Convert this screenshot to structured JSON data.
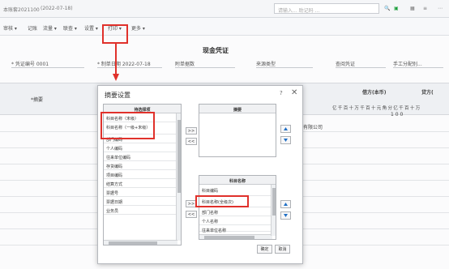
{
  "window": {
    "doc_code": "本账套2021100",
    "date_top": "(2022-07-18)",
    "search_placeholder": "请输入... 助记码 ..."
  },
  "toolbar": {
    "items": [
      "审核 ▾",
      "记账",
      "流量 ▾",
      "联查 ▾",
      "设置 ▾",
      "打印 ▾",
      "更多 ▾"
    ]
  },
  "voucher": {
    "title": "现金凭证",
    "voucher_no_label": "* 凭证编号 0001",
    "date_label": "* 制单日期 2022-07-18",
    "attach_label": "附单据数",
    "source_label": "来源类型",
    "summary_label": "查阅凭证",
    "manual_label": "手工分配别...",
    "col_summary": "*摘要",
    "col_debit": "借方(本币)",
    "col_credit": "贷方(",
    "money_units": "亿 千 百 十 万 千 百 十 元 角 分 亿 千 百 十 万",
    "row1_amount": "1 0 0",
    "row1_company": "有限公司"
  },
  "dialog": {
    "title": "摘要设置",
    "help_icon": "?",
    "close_icon": "✕",
    "pending_header": "待选择项",
    "pending_items": [
      "科目名称（末级）",
      "科目名称（一级+末级）",
      "部门编码",
      "个人编码",
      "往来单位编码",
      "存货编码",
      "项目编码",
      "结算方式",
      "票据号",
      "票据日期",
      "业务员"
    ],
    "summary_header": "摘要",
    "subject_header": "科目名称",
    "subject_items": [
      "科目编码",
      "科目名称(全级次)",
      "部门名称",
      "个人名称",
      "往来单位名称"
    ],
    "move_right": ">>",
    "move_left": "<<",
    "ok": "确定",
    "cancel": "取消"
  }
}
